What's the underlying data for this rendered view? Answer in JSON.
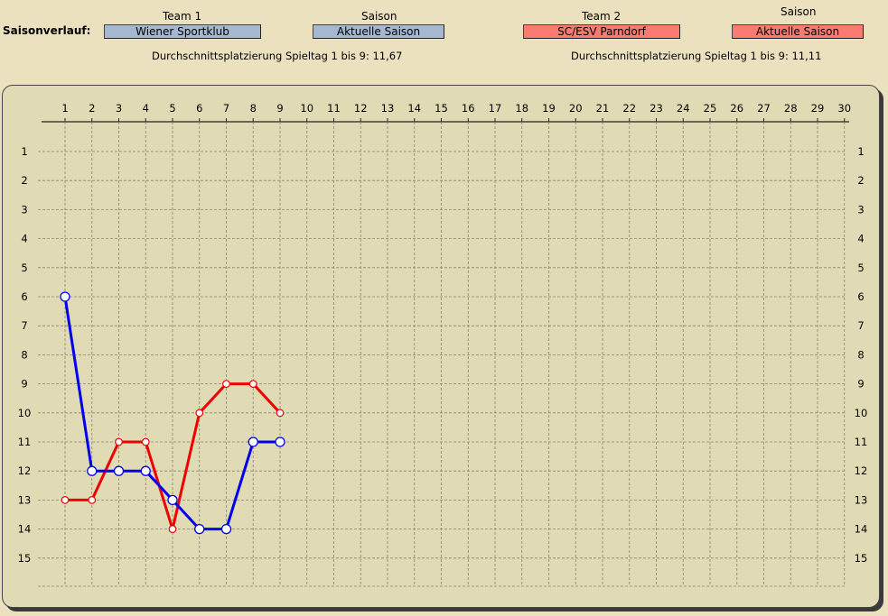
{
  "header": {
    "main_label": "Saisonverlauf:",
    "team1": {
      "heading": "Team 1",
      "value": "Wiener Sportklub"
    },
    "season1": {
      "heading": "Saison",
      "value": "Aktuelle Saison"
    },
    "team2": {
      "heading": "Team 2",
      "value": "SC/ESV Parndorf"
    },
    "season2": {
      "heading": "Saison",
      "value": "Aktuelle Saison"
    },
    "avg1": "Durchschnittsplatzierung Spieltag 1 bis 9: 11,67",
    "avg2": "Durchschnittsplatzierung Spieltag 1 bis 9: 11,11"
  },
  "colors": {
    "team1": "#0000ee",
    "team2": "#ee0000"
  },
  "chart_data": {
    "type": "line",
    "x": [
      1,
      2,
      3,
      4,
      5,
      6,
      7,
      8,
      9,
      10,
      11,
      12,
      13,
      14,
      15,
      16,
      17,
      18,
      19,
      20,
      21,
      22,
      23,
      24,
      25,
      26,
      27,
      28,
      29,
      30
    ],
    "xlim": [
      1,
      30
    ],
    "ylim": [
      1,
      15
    ],
    "y_inverted": true,
    "y_ticks": [
      1,
      2,
      3,
      4,
      5,
      6,
      7,
      8,
      9,
      10,
      11,
      12,
      13,
      14,
      15
    ],
    "grid": true,
    "series": [
      {
        "name": "Wiener Sportklub",
        "color": "#0000ee",
        "x": [
          1,
          2,
          3,
          4,
          5,
          6,
          7,
          8,
          9
        ],
        "values": [
          6,
          12,
          12,
          12,
          13,
          14,
          14,
          11,
          11
        ]
      },
      {
        "name": "SC/ESV Parndorf",
        "color": "#ee0000",
        "x": [
          1,
          2,
          3,
          4,
          5,
          6,
          7,
          8,
          9
        ],
        "values": [
          13,
          13,
          11,
          11,
          14,
          10,
          9,
          9,
          10
        ]
      }
    ]
  }
}
